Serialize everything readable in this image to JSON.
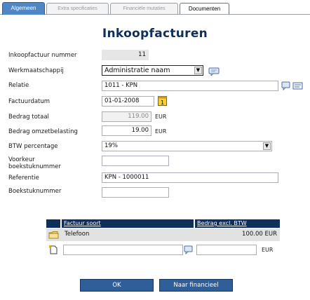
{
  "tabs": [
    {
      "label": "Algemeen",
      "active": true
    },
    {
      "label": "Extra specificaties",
      "active": false
    },
    {
      "label": "Financiële mutaties",
      "active": false
    },
    {
      "label": "Documenten",
      "active": false
    }
  ],
  "title": "Inkoopfacturen",
  "form": {
    "invoice_number": {
      "label": "Inkoopfactuur nummer",
      "value": "11"
    },
    "company": {
      "label": "Werkmaatschappij",
      "value": "Administratie naam"
    },
    "relation": {
      "label": "Relatie",
      "value": "1011 - KPN"
    },
    "invoice_date": {
      "label": "Factuurdatum",
      "value": "01-01-2008"
    },
    "total_amount": {
      "label": "Bedrag totaal",
      "value": "119.00",
      "unit": "EUR"
    },
    "vat_amount": {
      "label": "Bedrag omzetbelasting",
      "value": "19.00",
      "unit": "EUR"
    },
    "vat_percentage": {
      "label": "BTW percentage",
      "value": "19%"
    },
    "preferred_number": {
      "label_line1": "Voorkeur",
      "label_line2": "boekstuknummer",
      "value": ""
    },
    "reference": {
      "label": "Referentie",
      "value": "KPN - 1000011"
    },
    "booking_number": {
      "label": "Boekstuknummer",
      "value": ""
    }
  },
  "table": {
    "headers": [
      "Factuur soort",
      "Bedrag excl. BTW"
    ],
    "rows": [
      {
        "type": "Telefoon",
        "amount": "100.00 EUR"
      }
    ],
    "new_row": {
      "type": "",
      "amount": "",
      "unit": "EUR"
    }
  },
  "buttons": {
    "ok": "OK",
    "financial": "Naar financieel"
  },
  "icons": {
    "comment": "comment-icon",
    "calendar": "calendar-icon",
    "folder": "folder-icon",
    "new": "new-row-icon"
  },
  "colors": {
    "title": "#0f2f5c",
    "table_header": "#0f2f5c",
    "button": "#2f5f9a",
    "active_tab": "#4f86c6"
  }
}
